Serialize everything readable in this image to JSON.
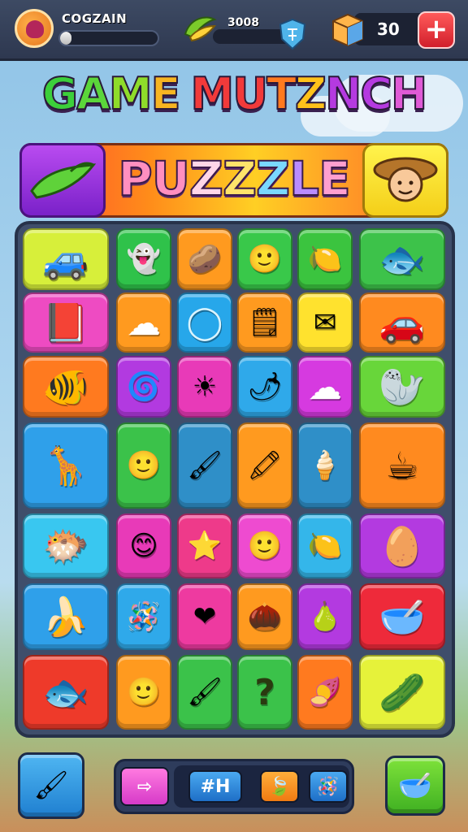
{
  "hud": {
    "player_name": "COGZAIN",
    "coins": "3008",
    "gems": "30",
    "plus_label": "+",
    "progress_fraction": 0.12
  },
  "title": {
    "letters": [
      {
        "ch": "G",
        "color": "#3ccf3a"
      },
      {
        "ch": "A",
        "color": "#5bd63a"
      },
      {
        "ch": "M",
        "color": "#8fdc2a"
      },
      {
        "ch": "E",
        "color": "#f7b521"
      },
      {
        "ch": " ",
        "color": "#ffffff"
      },
      {
        "ch": "M",
        "color": "#f23a3a"
      },
      {
        "ch": "U",
        "color": "#f23a3a"
      },
      {
        "ch": "T",
        "color": "#ff7a1f"
      },
      {
        "ch": "Z",
        "color": "#ffc21a"
      },
      {
        "ch": "N",
        "color": "#b53ae0"
      },
      {
        "ch": "C",
        "color": "#b53ae0"
      },
      {
        "ch": "H",
        "color": "#e05ad6"
      }
    ]
  },
  "banner": {
    "letters": [
      {
        "ch": "P",
        "color": "#ff8fc0"
      },
      {
        "ch": "U",
        "color": "#ff8fc0"
      },
      {
        "ch": "Z",
        "color": "#ffd6e8"
      },
      {
        "ch": "Z",
        "color": "#ffe36a"
      },
      {
        "ch": "Z",
        "color": "#7ad8ff"
      },
      {
        "ch": "L",
        "color": "#b98cff"
      },
      {
        "ch": "E",
        "color": "#ff9fcf"
      }
    ],
    "left_icon": "pea-pod-icon",
    "right_icon": "farmer-face-icon"
  },
  "tiles": [
    {
      "icon": "car-icon",
      "glyph": "🚙",
      "color": "#d7ef3a"
    },
    {
      "icon": "ghost-icon",
      "glyph": "👻",
      "color": "#2fc24a"
    },
    {
      "icon": "potato-icon",
      "glyph": "🥔",
      "color": "#ff9a1f"
    },
    {
      "icon": "smiley-face-icon",
      "glyph": "🙂",
      "color": "#39c84a"
    },
    {
      "icon": "lemon-icon",
      "glyph": "🍋",
      "color": "#3bc43f"
    },
    {
      "icon": "fish-icon",
      "glyph": "🐟",
      "color": "#3dc24a"
    },
    {
      "icon": "book-icon",
      "glyph": "📕",
      "color": "#ee4bc2"
    },
    {
      "icon": "cloud-icon",
      "glyph": "☁",
      "color": "#ff9a1f"
    },
    {
      "icon": "ring-icon",
      "glyph": "◯",
      "color": "#27a7ea"
    },
    {
      "icon": "sticky-note-icon",
      "glyph": "🗒",
      "color": "#ff9a1f"
    },
    {
      "icon": "paper-plane-icon",
      "glyph": "✉",
      "color": "#ffe22e"
    },
    {
      "icon": "red-car-icon",
      "glyph": "🚗",
      "color": "#ff8a1f"
    },
    {
      "icon": "fish-icon",
      "glyph": "🐠",
      "color": "#ff7a1f"
    },
    {
      "icon": "spiral-icon",
      "glyph": "🌀",
      "color": "#b23ae0"
    },
    {
      "icon": "sun-icon",
      "glyph": "☀",
      "color": "#e83ab8"
    },
    {
      "icon": "chili-pepper-icon",
      "glyph": "🌶",
      "color": "#2fa9ea"
    },
    {
      "icon": "cloud-icon",
      "glyph": "☁",
      "color": "#d63ae0"
    },
    {
      "icon": "seal-icon",
      "glyph": "🦭",
      "color": "#68d63a"
    },
    {
      "icon": "giraffe-icon",
      "glyph": "🦒",
      "color": "#2fa0ea"
    },
    {
      "icon": "face-icon",
      "glyph": "🙂",
      "color": "#3bc24a"
    },
    {
      "icon": "paintbrush-icon",
      "glyph": "🖌",
      "color": "#2f8fc8"
    },
    {
      "icon": "crayon-icon",
      "glyph": "🖍",
      "color": "#ff9a1f"
    },
    {
      "icon": "ice-cream-icon",
      "glyph": "🍦",
      "color": "#2f8fc8"
    },
    {
      "icon": "teacup-icon",
      "glyph": "☕",
      "color": "#ff8a1f"
    },
    {
      "icon": "fish-icon",
      "glyph": "🐡",
      "color": "#39c7f0"
    },
    {
      "icon": "face-icon",
      "glyph": "😊",
      "color": "#e83ab8"
    },
    {
      "icon": "star-icon",
      "glyph": "⭐",
      "color": "#ee3a8a"
    },
    {
      "icon": "smiley-face-icon",
      "glyph": "🙂",
      "color": "#ee4bd0"
    },
    {
      "icon": "lemon-icon",
      "glyph": "🍋",
      "color": "#34b6ea"
    },
    {
      "icon": "yellow-blob-icon",
      "glyph": "🥚",
      "color": "#b33ae0"
    },
    {
      "icon": "banana-icon",
      "glyph": "🍌",
      "color": "#2fa0ea"
    },
    {
      "icon": "rattle-icon",
      "glyph": "🪅",
      "color": "#2fa9ea"
    },
    {
      "icon": "heart-icon",
      "glyph": "❤",
      "color": "#ee3aa0"
    },
    {
      "icon": "nut-icon",
      "glyph": "🌰",
      "color": "#ff9a1f"
    },
    {
      "icon": "pear-icon",
      "glyph": "🍐",
      "color": "#b33ae0"
    },
    {
      "icon": "bowl-icon",
      "glyph": "🥣",
      "color": "#ee2a3a"
    },
    {
      "icon": "fish-icon",
      "glyph": "🐟",
      "color": "#ee3a2a"
    },
    {
      "icon": "face-icon",
      "glyph": "🙂",
      "color": "#ff9a1f"
    },
    {
      "icon": "brush-icon",
      "glyph": "🖌",
      "color": "#3bc24a"
    },
    {
      "icon": "question-mark-icon",
      "glyph": "?",
      "color": "#3bc24a"
    },
    {
      "icon": "sweet-potato-icon",
      "glyph": "🍠",
      "color": "#ff7a1f"
    },
    {
      "icon": "cucumber-icon",
      "glyph": "🥒",
      "color": "#e6f23a"
    }
  ],
  "bottom": {
    "left_button_icon": "paintbrush-icon",
    "arrow_icon": "arrow-right-icon",
    "tray_label": "#H",
    "tray_item_2_icon": "leaf-icon",
    "tray_item_3_icon": "rattle-icon",
    "right_button_icon": "bowl-icon"
  }
}
